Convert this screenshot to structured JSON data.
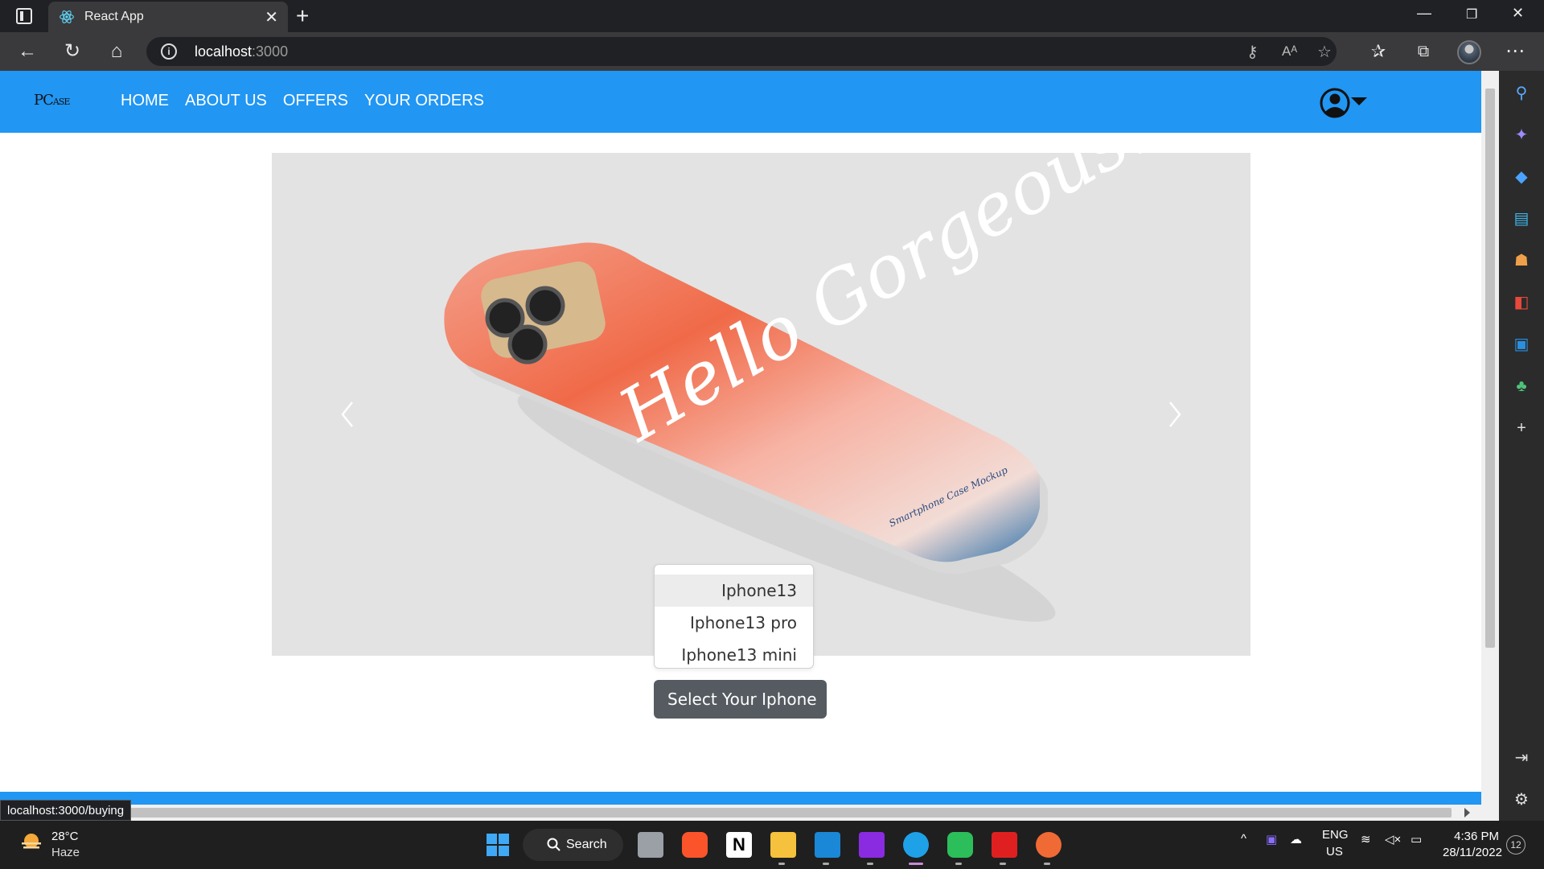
{
  "browser": {
    "tab_title": "React App",
    "url_host": "localhost",
    "url_port": ":3000",
    "status_url": "localhost:3000/buying"
  },
  "site": {
    "brand_main": "PC",
    "brand_rest": "ASE",
    "nav": [
      "HOME",
      "ABOUT US",
      "OFFERS",
      "YOUR ORDERS"
    ],
    "accent_color": "#2196f3"
  },
  "carousel": {
    "image_text": "Hello Gorgeous!",
    "image_subtext": "Smartphone Case Mockup"
  },
  "dropdown": {
    "toggle_label": "Select Your Iphone",
    "items": [
      "Iphone13",
      "Iphone13 pro",
      "Iphone13 mini"
    ],
    "active_index": 0
  },
  "taskbar": {
    "temperature": "28°C",
    "weather": "Haze",
    "search_label": "Search",
    "lang_top": "ENG",
    "lang_bottom": "US",
    "time": "4:36 PM",
    "date": "28/11/2022",
    "notifications": "12"
  }
}
